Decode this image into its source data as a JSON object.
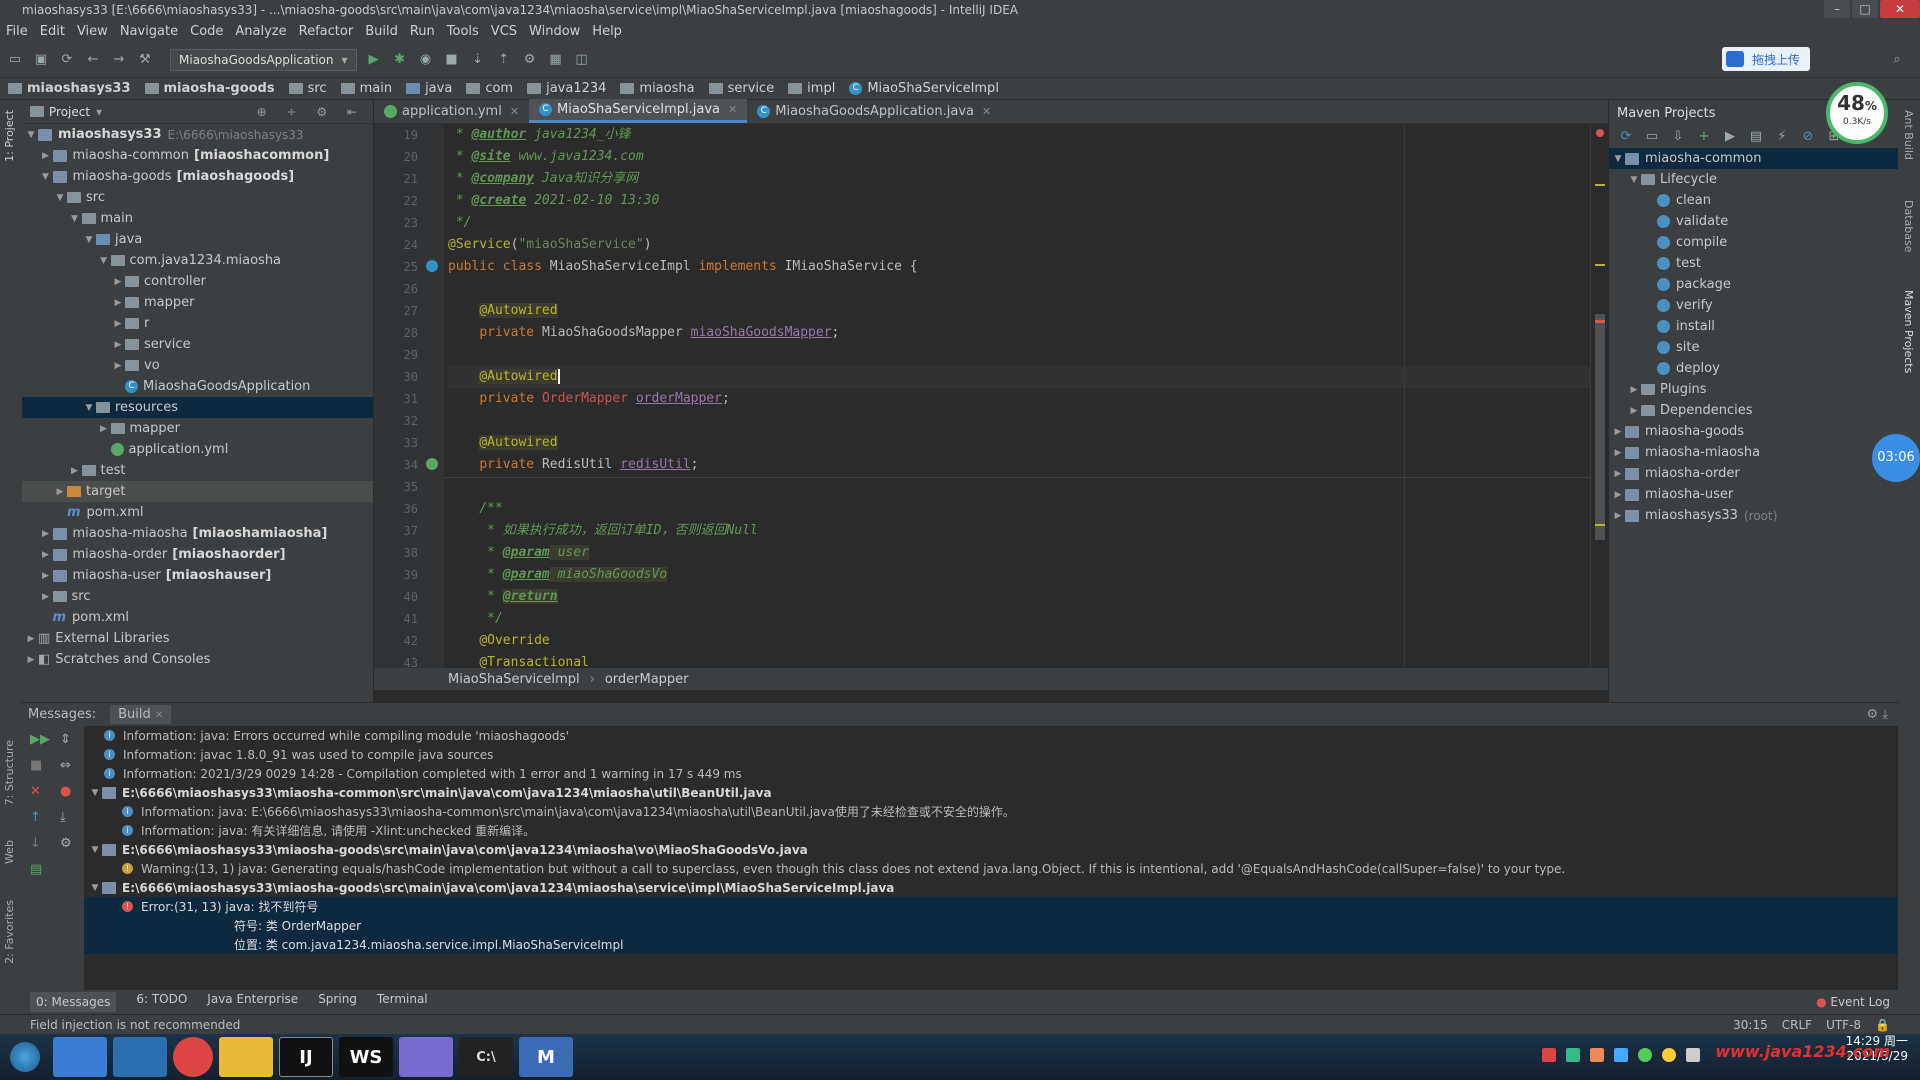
{
  "window": {
    "title": "miaoshasys33 [E:\\6666\\miaoshasys33] - ...\\miaosha-goods\\src\\main\\java\\com\\java1234\\miaosha\\service\\impl\\MiaoShaServiceImpl.java [miaoshagoods] - IntelliJ IDEA"
  },
  "menu": [
    "File",
    "Edit",
    "View",
    "Navigate",
    "Code",
    "Analyze",
    "Refactor",
    "Build",
    "Run",
    "Tools",
    "VCS",
    "Window",
    "Help"
  ],
  "toolbar": {
    "run_config": "MiaoshaGoodsApplication",
    "upload_label": "拖拽上传"
  },
  "breadcrumbs": [
    "miaoshasys33",
    "miaosha-goods",
    "src",
    "main",
    "java",
    "com",
    "java1234",
    "miaosha",
    "service",
    "impl",
    "MiaoShaServiceImpl"
  ],
  "project": {
    "header": "Project",
    "tree": [
      {
        "indent": 0,
        "arrow": "▼",
        "icon": "module",
        "label": "miaoshasys33",
        "extra": "E:\\6666\\miaoshasys33",
        "bold": true
      },
      {
        "indent": 1,
        "arrow": "▶",
        "icon": "module",
        "label": "miaosha-common",
        "extra2": "[miaoshacommon]"
      },
      {
        "indent": 1,
        "arrow": "▼",
        "icon": "module",
        "label": "miaosha-goods",
        "extra2": "[miaoshagoods]"
      },
      {
        "indent": 2,
        "arrow": "▼",
        "icon": "folder",
        "label": "src"
      },
      {
        "indent": 3,
        "arrow": "▼",
        "icon": "folder",
        "label": "main"
      },
      {
        "indent": 4,
        "arrow": "▼",
        "icon": "folder-blue",
        "label": "java"
      },
      {
        "indent": 5,
        "arrow": "▼",
        "icon": "folder",
        "label": "com.java1234.miaosha"
      },
      {
        "indent": 6,
        "arrow": "▶",
        "icon": "folder",
        "label": "controller"
      },
      {
        "indent": 6,
        "arrow": "▶",
        "icon": "folder",
        "label": "mapper"
      },
      {
        "indent": 6,
        "arrow": "▶",
        "icon": "folder",
        "label": "r"
      },
      {
        "indent": 6,
        "arrow": "▶",
        "icon": "folder",
        "label": "service"
      },
      {
        "indent": 6,
        "arrow": "▶",
        "icon": "folder",
        "label": "vo"
      },
      {
        "indent": 6,
        "arrow": "",
        "icon": "class",
        "label": "MiaoshaGoodsApplication"
      },
      {
        "indent": 4,
        "arrow": "▼",
        "icon": "folder",
        "label": "resources",
        "selected": true
      },
      {
        "indent": 5,
        "arrow": "▶",
        "icon": "folder",
        "label": "mapper"
      },
      {
        "indent": 5,
        "arrow": "",
        "icon": "yml",
        "label": "application.yml"
      },
      {
        "indent": 3,
        "arrow": "▶",
        "icon": "folder",
        "label": "test"
      },
      {
        "indent": 2,
        "arrow": "▶",
        "icon": "folder-orange",
        "label": "target",
        "highlight": true
      },
      {
        "indent": 2,
        "arrow": "",
        "icon": "maven",
        "label": "pom.xml"
      },
      {
        "indent": 1,
        "arrow": "▶",
        "icon": "module",
        "label": "miaosha-miaosha",
        "extra2": "[miaoshamiaosha]"
      },
      {
        "indent": 1,
        "arrow": "▶",
        "icon": "module",
        "label": "miaosha-order",
        "extra2": "[miaoshaorder]"
      },
      {
        "indent": 1,
        "arrow": "▶",
        "icon": "module",
        "label": "miaosha-user",
        "extra2": "[miaoshauser]"
      },
      {
        "indent": 1,
        "arrow": "▶",
        "icon": "folder",
        "label": "src"
      },
      {
        "indent": 1,
        "arrow": "",
        "icon": "maven",
        "label": "pom.xml"
      },
      {
        "indent": 0,
        "arrow": "▶",
        "icon": "lib",
        "label": "External Libraries"
      },
      {
        "indent": 0,
        "arrow": "▶",
        "icon": "scratch",
        "label": "Scratches and Consoles"
      }
    ]
  },
  "editor": {
    "tabs": [
      {
        "label": "application.yml",
        "active": false
      },
      {
        "label": "MiaoShaServiceImpl.java",
        "active": true
      },
      {
        "label": "MiaoshaGoodsApplication.java",
        "active": false
      }
    ],
    "line_numbers": [
      "19",
      "20",
      "21",
      "22",
      "23",
      "24",
      "25",
      "26",
      "27",
      "28",
      "29",
      "30",
      "31",
      "32",
      "33",
      "34",
      "35",
      "36",
      "37",
      "38",
      "39",
      "40",
      "41",
      "42",
      "43"
    ],
    "code_crumb": [
      "MiaoShaServiceImpl",
      "orderMapper"
    ]
  },
  "maven": {
    "header": "Maven Projects",
    "tree": [
      {
        "indent": 0,
        "arrow": "▼",
        "icon": "module",
        "label": "miaosha-common",
        "selected": true
      },
      {
        "indent": 1,
        "arrow": "▼",
        "icon": "folder",
        "label": "Lifecycle"
      },
      {
        "indent": 2,
        "arrow": "",
        "icon": "gear",
        "label": "clean"
      },
      {
        "indent": 2,
        "arrow": "",
        "icon": "gear",
        "label": "validate"
      },
      {
        "indent": 2,
        "arrow": "",
        "icon": "gear",
        "label": "compile"
      },
      {
        "indent": 2,
        "arrow": "",
        "icon": "gear",
        "label": "test"
      },
      {
        "indent": 2,
        "arrow": "",
        "icon": "gear",
        "label": "package"
      },
      {
        "indent": 2,
        "arrow": "",
        "icon": "gear",
        "label": "verify"
      },
      {
        "indent": 2,
        "arrow": "",
        "icon": "gear",
        "label": "install"
      },
      {
        "indent": 2,
        "arrow": "",
        "icon": "gear",
        "label": "site"
      },
      {
        "indent": 2,
        "arrow": "",
        "icon": "gear",
        "label": "deploy"
      },
      {
        "indent": 1,
        "arrow": "▶",
        "icon": "folder",
        "label": "Plugins"
      },
      {
        "indent": 1,
        "arrow": "▶",
        "icon": "folder",
        "label": "Dependencies"
      },
      {
        "indent": 0,
        "arrow": "▶",
        "icon": "module",
        "label": "miaosha-goods"
      },
      {
        "indent": 0,
        "arrow": "▶",
        "icon": "module",
        "label": "miaosha-miaosha"
      },
      {
        "indent": 0,
        "arrow": "▶",
        "icon": "module",
        "label": "miaosha-order"
      },
      {
        "indent": 0,
        "arrow": "▶",
        "icon": "module",
        "label": "miaosha-user"
      },
      {
        "indent": 0,
        "arrow": "▶",
        "icon": "module",
        "label": "miaoshasys33",
        "extra": "(root)"
      }
    ]
  },
  "messages": {
    "label": "Messages:",
    "tab": "Build",
    "lines": [
      {
        "indent": 0,
        "icon": "info",
        "text": "Information: java: Errors occurred while compiling module 'miaoshagoods'"
      },
      {
        "indent": 0,
        "icon": "info",
        "text": "Information: javac 1.8.0_91 was used to compile java sources"
      },
      {
        "indent": 0,
        "icon": "info",
        "text": "Information: 2021/3/29 0029 14:28 - Compilation completed with 1 error and 1 warning in 17 s 449 ms"
      },
      {
        "indent": 0,
        "icon": "file",
        "arrow": "▼",
        "bold": true,
        "text": "E:\\6666\\miaoshasys33\\miaosha-common\\src\\main\\java\\com\\java1234\\miaosha\\util\\BeanUtil.java"
      },
      {
        "indent": 1,
        "icon": "info",
        "text": "Information: java: E:\\6666\\miaoshasys33\\miaosha-common\\src\\main\\java\\com\\java1234\\miaosha\\util\\BeanUtil.java使用了未经检查或不安全的操作。"
      },
      {
        "indent": 1,
        "icon": "info",
        "text": "Information: java: 有关详细信息, 请使用 -Xlint:unchecked 重新编译。"
      },
      {
        "indent": 0,
        "icon": "file",
        "arrow": "▼",
        "bold": true,
        "text": "E:\\6666\\miaoshasys33\\miaosha-goods\\src\\main\\java\\com\\java1234\\miaosha\\vo\\MiaoShaGoodsVo.java"
      },
      {
        "indent": 1,
        "icon": "warn",
        "text": "Warning:(13, 1)  java: Generating equals/hashCode implementation but without a call to superclass, even though this class does not extend java.lang.Object. If this is intentional, add '@EqualsAndHashCode(callSuper=false)' to your type."
      },
      {
        "indent": 0,
        "icon": "file",
        "arrow": "▼",
        "bold": true,
        "text": "E:\\6666\\miaoshasys33\\miaosha-goods\\src\\main\\java\\com\\java1234\\miaosha\\service\\impl\\MiaoShaServiceImpl.java"
      },
      {
        "indent": 1,
        "icon": "error",
        "text": "Error:(31, 13)  java: 找不到符号",
        "selected": true
      },
      {
        "indent": 2,
        "icon": "",
        "text": "符号:   类 OrderMapper",
        "selected": true
      },
      {
        "indent": 2,
        "icon": "",
        "text": "位置: 类 com.java1234.miaosha.service.impl.MiaoShaServiceImpl",
        "selected": true
      }
    ]
  },
  "bottom_tabs": [
    "0: Messages",
    "6: TODO",
    "Java Enterprise",
    "Spring",
    "Terminal"
  ],
  "event_log": "Event Log",
  "status": {
    "message": "Field injection is not recommended",
    "position": "30:15",
    "line_sep": "CRLF",
    "encoding": "UTF-8"
  },
  "overlay": {
    "cpu_percent": "48",
    "net_speed": "0.3K/s",
    "timer": "03:06"
  },
  "taskbar": {
    "time": "14:29 周一",
    "date": "2021/3/29",
    "watermark": "www.java1234.com"
  }
}
